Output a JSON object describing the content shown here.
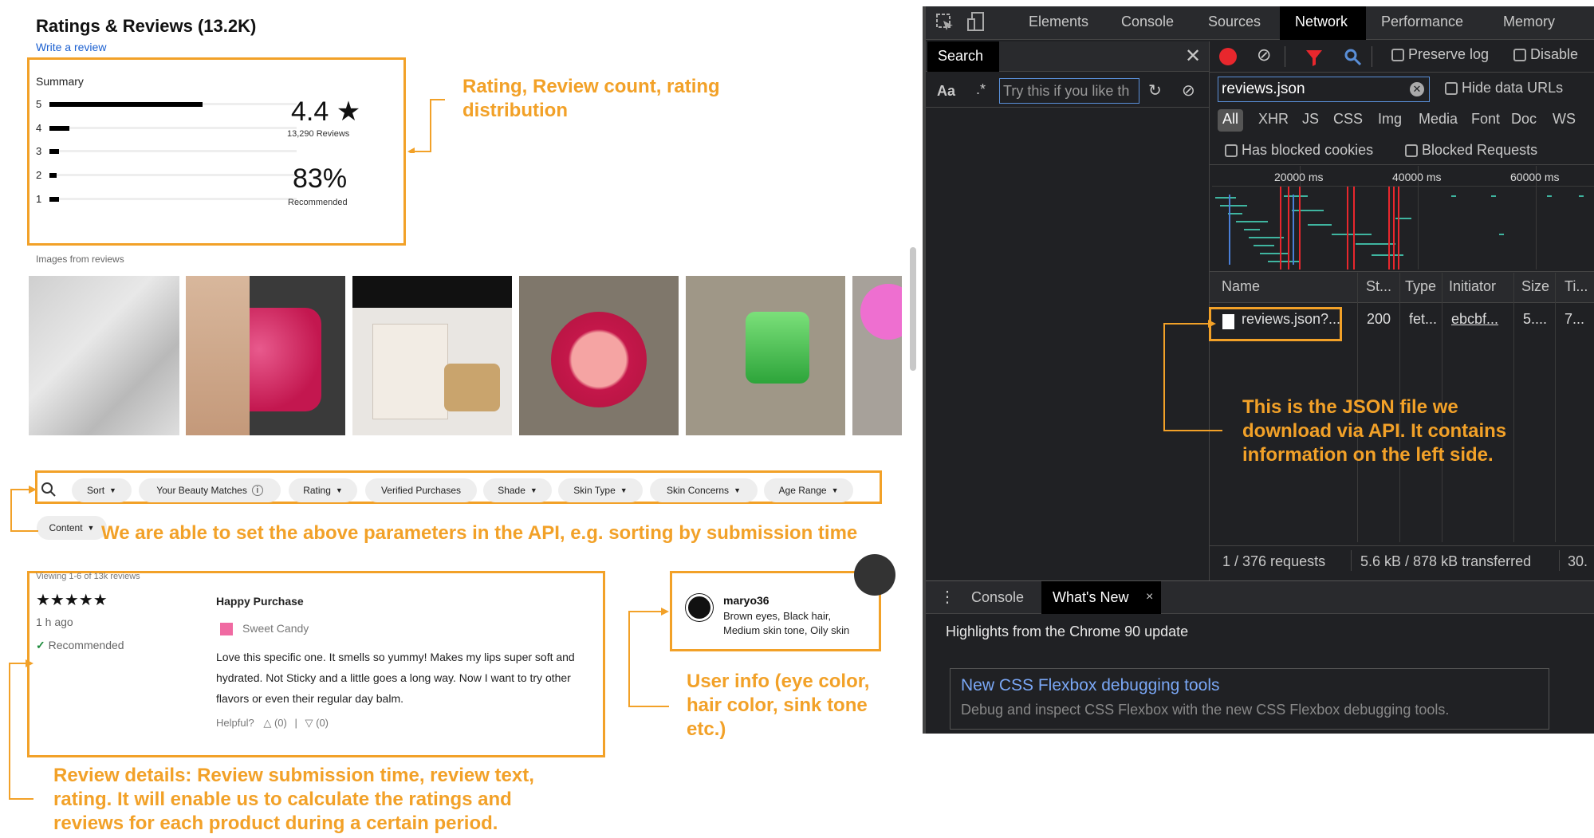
{
  "left": {
    "title": "Ratings & Reviews (13.2K)",
    "write_review": "Write a review",
    "summary_label": "Summary",
    "rating_rows": [
      {
        "star": "5",
        "fraction": 0.62
      },
      {
        "star": "4",
        "fraction": 0.08
      },
      {
        "star": "3",
        "fraction": 0.04
      },
      {
        "star": "2",
        "fraction": 0.03
      },
      {
        "star": "1",
        "fraction": 0.04
      }
    ],
    "avg_rating": "4.4 ★",
    "review_count": "13,290 Reviews",
    "recommend_pct": "83%",
    "recommend_label": "Recommended",
    "images_label": "Images from reviews",
    "filters": [
      "Sort",
      "Your Beauty Matches",
      "Rating",
      "Verified Purchases",
      "Shade",
      "Skin Type",
      "Skin Concerns",
      "Age Range"
    ],
    "filter_row2": "Content",
    "viewing": "Viewing 1-6 of 13k reviews",
    "review": {
      "stars": "★★★★★",
      "time": "1 h ago",
      "recommended": "Recommended",
      "title": "Happy Purchase",
      "shade": "Sweet Candy",
      "text": [
        "Love this specific one. It smells so yummy! Makes my lips super soft and",
        "hydrated. Not Sticky and a little goes a long way. Now I want to try other",
        "flavors or even their regular day balm."
      ],
      "helpful": "Helpful?",
      "up": "(0)",
      "down": "(0)",
      "sep": "|"
    },
    "user": {
      "name": "maryo36",
      "line1": "Brown eyes, Black hair,",
      "line2": "Medium skin tone, Oily skin"
    },
    "annotations": {
      "rating": [
        "Rating, Review count, rating",
        "distribution"
      ],
      "params": "We are able to set the above parameters in the API, e.g. sorting by submission time",
      "user": [
        "User info (eye color,",
        "hair color, sink tone",
        "etc.)"
      ],
      "review": [
        "Review details: Review submission time, review text,",
        "rating. It will enable us to calculate the ratings and",
        "reviews for each product during a certain period."
      ],
      "json": [
        "This is the JSON file  we",
        "download via API. It contains",
        "information on the left side."
      ]
    }
  },
  "devtools": {
    "tabs": [
      "Elements",
      "Console",
      "Sources",
      "Network",
      "Performance",
      "Memory"
    ],
    "active_tab": "Network",
    "search_title": "Search",
    "search_aa": "Aa",
    "search_regex": ".*",
    "search_placeholder": "Try this if you like th",
    "filter_value": "reviews.json",
    "preserve_log": "Preserve log",
    "disable": "Disable",
    "hide_data_urls": "Hide data URLs",
    "types": [
      "All",
      "XHR",
      "JS",
      "CSS",
      "Img",
      "Media",
      "Font",
      "Doc",
      "WS"
    ],
    "blocked_cookies": "Has blocked cookies",
    "blocked_requests": "Blocked Requests",
    "timeline_ticks": [
      "20000 ms",
      "40000 ms",
      "60000 ms"
    ],
    "columns": [
      "Name",
      "St...",
      "Type",
      "Initiator",
      "Size",
      "Ti..."
    ],
    "row": [
      "reviews.json?...",
      "200",
      "fet...",
      "ebcbf...",
      "5....",
      "7..."
    ],
    "status_requests": "1 / 376 requests",
    "status_transfer": "5.6 kB / 878 kB transferred",
    "status_time": "30.",
    "drawer_tabs": [
      "Console",
      "What's New"
    ],
    "drawer_close": "×",
    "highlights": "Highlights from the Chrome 90 update",
    "card_title": "New CSS Flexbox debugging tools",
    "card_text": "Debug and inspect CSS Flexbox with the new CSS Flexbox debugging tools."
  },
  "colors": {
    "accent": "#f2a128",
    "link": "#1a5fd0",
    "devtools_bg": "#202124",
    "record": "#e8272d"
  }
}
